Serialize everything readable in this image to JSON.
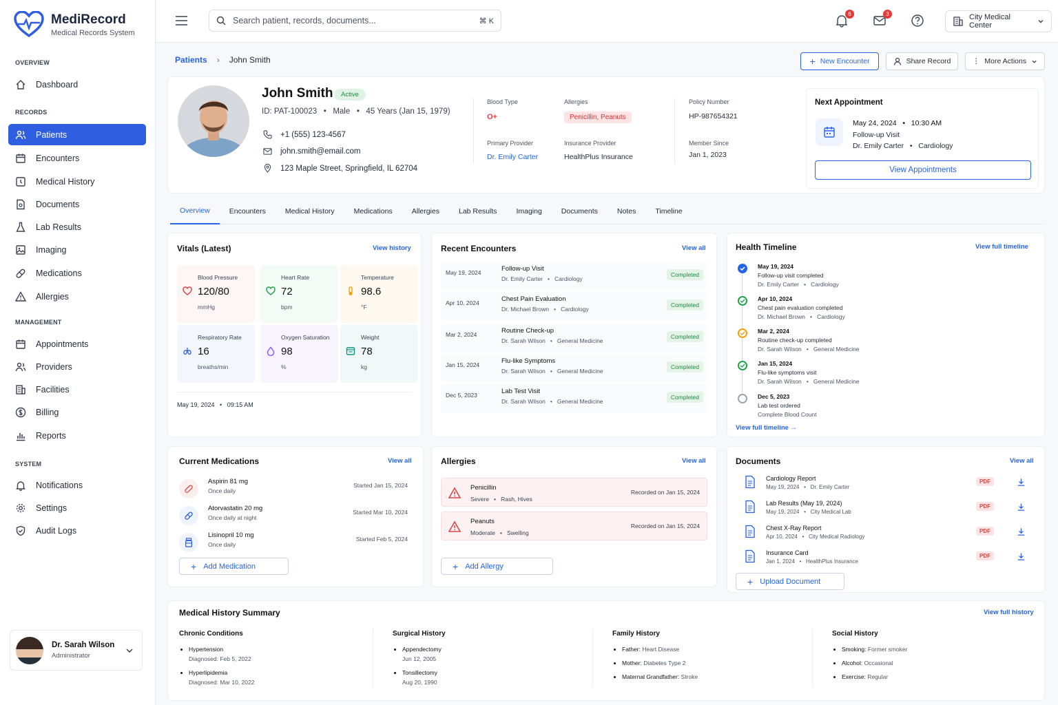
{
  "app": {
    "name": "MediRecord",
    "subtitle": "Medical Records System"
  },
  "sidebar": {
    "overview_label": "OVERVIEW",
    "records_label": "RECORDS",
    "management_label": "MANAGEMENT",
    "system_label": "SYSTEM",
    "items": [
      {
        "label": "Dashboard",
        "icon": "home-icon"
      },
      {
        "label": "Patients",
        "icon": "users-icon"
      },
      {
        "label": "Encounters",
        "icon": "calendar-icon"
      },
      {
        "label": "Medical History",
        "icon": "history-icon"
      },
      {
        "label": "Documents",
        "icon": "document-icon"
      },
      {
        "label": "Lab Results",
        "icon": "flask-icon"
      },
      {
        "label": "Imaging",
        "icon": "image-icon"
      },
      {
        "label": "Medications",
        "icon": "pill-icon"
      },
      {
        "label": "Allergies",
        "icon": "warning-icon"
      },
      {
        "label": "Appointments",
        "icon": "calendar-icon"
      },
      {
        "label": "Providers",
        "icon": "users-icon"
      },
      {
        "label": "Facilities",
        "icon": "building-icon"
      },
      {
        "label": "Billing",
        "icon": "dollar-icon"
      },
      {
        "label": "Reports",
        "icon": "chart-icon"
      },
      {
        "label": "Notifications",
        "icon": "bell-icon"
      },
      {
        "label": "Settings",
        "icon": "gear-icon"
      },
      {
        "label": "Audit Logs",
        "icon": "shield-icon"
      }
    ],
    "user": {
      "name": "Dr. Sarah Wilson",
      "role": "Administrator"
    }
  },
  "topbar": {
    "search_placeholder": "Search patient, records, documents...",
    "shortcut": "⌘ K",
    "notif_count": "6",
    "mail_count": "3",
    "facility": "City Medical Center"
  },
  "breadcrumb": {
    "root": "Patients",
    "current": "John Smith"
  },
  "actions": {
    "new_encounter": "New Encounter",
    "share": "Share Record",
    "more": "More Actions"
  },
  "patient": {
    "name": "John Smith",
    "status": "Active",
    "meta": "ID: PAT-100023   •   Male   •   45 Years (Jan 15, 1979)",
    "phone": "+1 (555) 123-4567",
    "email": "john.smith@email.com",
    "address": "123 Maple Street, Springfield, IL 62704",
    "blood_type_label": "Blood Type",
    "blood_type": "O+",
    "allergies_label": "Allergies",
    "allergies": "Penicillin, Peanuts",
    "policy_label": "Policy Number",
    "policy": "HP-987654321",
    "provider_label": "Primary Provider",
    "provider": "Dr. Emily Carter",
    "insurance_label": "Insurance Provider",
    "insurance": "HealthPlus Insurance",
    "member_label": "Member Since",
    "member": "Jan 1, 2023"
  },
  "appointment": {
    "title": "Next Appointment",
    "when": "May 24, 2024   •   10:30 AM",
    "type": "Follow-up Visit",
    "doctor": "Dr. Emily Carter   •   Cardiology",
    "button": "View Appointments"
  },
  "tabs": [
    "Overview",
    "Encounters",
    "Medical History",
    "Medications",
    "Allergies",
    "Lab Results",
    "Imaging",
    "Documents",
    "Notes",
    "Timeline"
  ],
  "vitals": {
    "title": "Vitals (Latest)",
    "link": "View history",
    "timestamp": "May 19, 2024   •   09:15 AM",
    "items": [
      {
        "label": "Blood Pressure",
        "value": "120/80",
        "unit": "mmHg"
      },
      {
        "label": "Heart Rate",
        "value": "72",
        "unit": "bpm"
      },
      {
        "label": "Temperature",
        "value": "98.6",
        "unit": "°F"
      },
      {
        "label": "Respiratory Rate",
        "value": "16",
        "unit": "breaths/min"
      },
      {
        "label": "Oxygen Saturation",
        "value": "98",
        "unit": "%"
      },
      {
        "label": "Weight",
        "value": "78",
        "unit": "kg"
      }
    ]
  },
  "encounters": {
    "title": "Recent Encounters",
    "link": "View all",
    "items": [
      {
        "date": "May 19, 2024",
        "title": "Follow-up Visit",
        "sub": "Dr. Emily Carter   •   Cardiology",
        "status": "Completed"
      },
      {
        "date": "Apr 10, 2024",
        "title": "Chest Pain Evaluation",
        "sub": "Dr. Michael Brown   •   Cardiology",
        "status": "Completed"
      },
      {
        "date": "Mar 2, 2024",
        "title": "Routine Check-up",
        "sub": "Dr. Sarah Wilson   •   General Medicine",
        "status": "Completed"
      },
      {
        "date": "Jan 15, 2024",
        "title": "Flu-like Symptoms",
        "sub": "Dr. Sarah Wilson   •   General Medicine",
        "status": "Completed"
      },
      {
        "date": "Dec 5, 2023",
        "title": "Lab Test Visit",
        "sub": "Dr. Sarah Wilson   •   General Medicine",
        "status": "Completed"
      }
    ]
  },
  "timeline": {
    "title": "Health Timeline",
    "link": "View full timeline",
    "footer": "View full timeline",
    "items": [
      {
        "date": "May 19, 2024",
        "event": "Follow-up visit completed",
        "detail": "Dr. Emily Carter   •   Cardiology",
        "color": "#2563eb"
      },
      {
        "date": "Apr 10, 2024",
        "event": "Chest pain evaluation completed",
        "detail": "Dr. Michael Brown   •   Cardiology",
        "color": "#22a34a"
      },
      {
        "date": "Mar 2, 2024",
        "event": "Routine check-up completed",
        "detail": "Dr. Sarah Wilson   •   General Medicine",
        "color": "#f59e0b"
      },
      {
        "date": "Jan 15, 2024",
        "event": "Flu-like symptoms visit",
        "detail": "Dr. Sarah Wilson   •   General Medicine",
        "color": "#22a34a"
      },
      {
        "date": "Dec 5, 2023",
        "event": "Lab test ordered",
        "detail": "Complete Blood Count",
        "color": "#9ca3af"
      }
    ]
  },
  "medications": {
    "title": "Current Medications",
    "link": "View all",
    "add": "Add Medication",
    "items": [
      {
        "name": "Aspirin 81 mg",
        "dose": "Once daily",
        "started": "Started Jan 15, 2024"
      },
      {
        "name": "Atorvastatin 20 mg",
        "dose": "Once daily at night",
        "started": "Started Mar 10, 2024"
      },
      {
        "name": "Lisinopril 10 mg",
        "dose": "Once daily",
        "started": "Started Feb 5, 2024"
      }
    ]
  },
  "allergy_list": {
    "title": "Allergies",
    "link": "View all",
    "add": "Add Allergy",
    "items": [
      {
        "name": "Penicillin",
        "detail": "Severe   •   Rash, Hives",
        "recorded": "Recorded on Jan 15, 2024"
      },
      {
        "name": "Peanuts",
        "detail": "Moderate   •   Swelling",
        "recorded": "Recorded on Jan 15, 2024"
      }
    ]
  },
  "documents": {
    "title": "Documents",
    "link": "View all",
    "upload": "Upload Document",
    "items": [
      {
        "name": "Cardiology Report",
        "meta": "May 19, 2024   •   Dr. Emily Carter",
        "type": "PDF"
      },
      {
        "name": "Lab Results (May 19, 2024)",
        "meta": "May 19, 2024   •   City Medical Lab",
        "type": "PDF"
      },
      {
        "name": "Chest X-Ray Report",
        "meta": "Apr 10, 2024   •   City Medical Radiology",
        "type": "PDF"
      },
      {
        "name": "Insurance Card",
        "meta": "Jan 1, 2024   •   HealthPlus Insurance",
        "type": "PDF"
      }
    ]
  },
  "history": {
    "title": "Medical History Summary",
    "link": "View full history",
    "chronic": {
      "title": "Chronic Conditions",
      "items": [
        {
          "name": "Hypertension",
          "sub": "Diagnosed: Feb 5, 2022"
        },
        {
          "name": "Hyperlipidemia",
          "sub": "Diagnosed: Mar 10, 2022"
        }
      ]
    },
    "surgical": {
      "title": "Surgical History",
      "items": [
        {
          "name": "Appendectomy",
          "sub": "Jun 12, 2005"
        },
        {
          "name": "Tonsillectomy",
          "sub": "Aug 20, 1990"
        }
      ]
    },
    "family": {
      "title": "Family History",
      "items": [
        {
          "k": "Father:",
          "v": "Heart Disease"
        },
        {
          "k": "Mother:",
          "v": "Diabetes Type 2"
        },
        {
          "k": "Maternal Grandfather:",
          "v": "Stroke"
        }
      ]
    },
    "social": {
      "title": "Social History",
      "items": [
        {
          "k": "Smoking:",
          "v": "Former smoker"
        },
        {
          "k": "Alcohol:",
          "v": "Occasional"
        },
        {
          "k": "Exercise:",
          "v": "Regular"
        }
      ]
    }
  },
  "colors": {
    "primary": "#2f5fe0",
    "success": "#1e8a43",
    "danger": "#e04545",
    "warning": "#f59e0b"
  }
}
